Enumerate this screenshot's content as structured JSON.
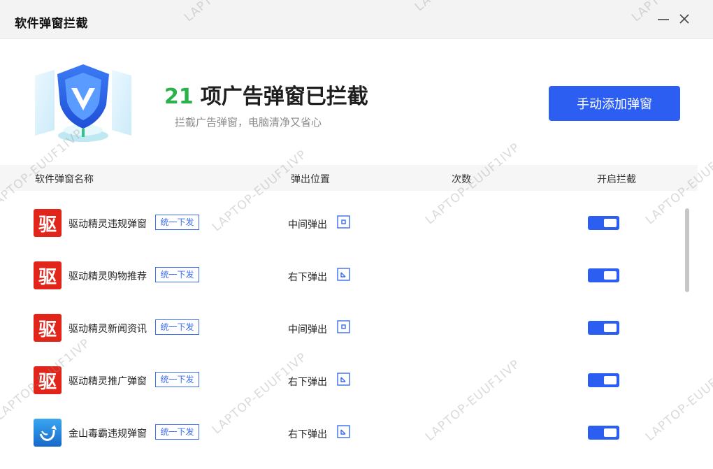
{
  "window": {
    "title": "软件弹窗拦截"
  },
  "summary": {
    "count": "21",
    "headline": "项广告弹窗已拦截",
    "subline": "拦截广告弹窗，电脑清净又省心",
    "add_button": "手动添加弹窗"
  },
  "table": {
    "headers": {
      "name": "软件弹窗名称",
      "position": "弹出位置",
      "count": "次数",
      "toggle": "开启拦截"
    },
    "rows": [
      {
        "icon_char": "驱",
        "icon": "driver-genius-icon",
        "name": "驱动精灵违规弹窗",
        "tag": "统一下发",
        "position": "中间弹出",
        "position_icon": "center-popup-icon",
        "enabled": true
      },
      {
        "icon_char": "驱",
        "icon": "driver-genius-icon",
        "name": "驱动精灵购物推荐",
        "tag": "统一下发",
        "position": "右下弹出",
        "position_icon": "bottom-right-popup-icon",
        "enabled": true
      },
      {
        "icon_char": "驱",
        "icon": "driver-genius-icon",
        "name": "驱动精灵新闻资讯",
        "tag": "统一下发",
        "position": "中间弹出",
        "position_icon": "center-popup-icon",
        "enabled": true
      },
      {
        "icon_char": "驱",
        "icon": "driver-genius-icon",
        "name": "驱动精灵推广弹窗",
        "tag": "统一下发",
        "position": "右下弹出",
        "position_icon": "bottom-right-popup-icon",
        "enabled": true
      },
      {
        "icon_char": "",
        "icon": "kingsoft-antivirus-icon",
        "name": "金山毒霸违规弹窗",
        "tag": "统一下发",
        "position": "右下弹出",
        "position_icon": "bottom-right-popup-icon",
        "enabled": true
      }
    ]
  },
  "watermark": "LAPTOP-EUUF1IVP",
  "colors": {
    "accent": "#2c5ef2",
    "count_green": "#2ab24d",
    "app_red": "#e1251b"
  }
}
